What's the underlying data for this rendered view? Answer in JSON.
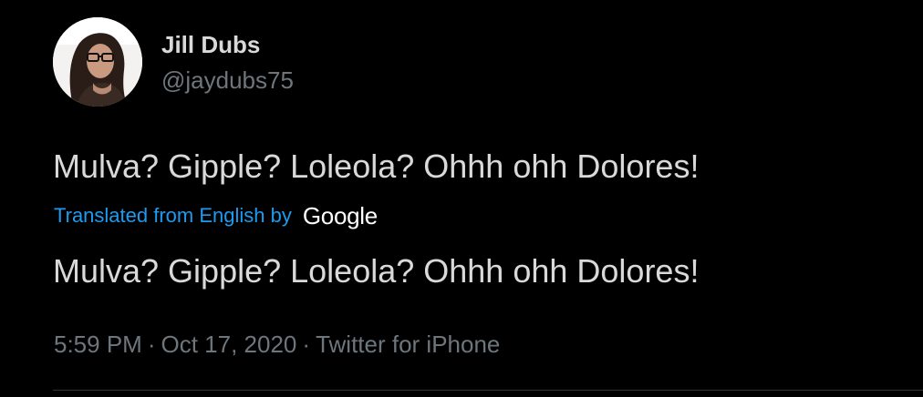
{
  "user": {
    "display_name": "Jill Dubs",
    "handle": "@jaydubs75",
    "avatar_icon": "profile-photo"
  },
  "tweet": {
    "text": "Mulva? Gipple? Loleola? Ohhh ohh Dolores!",
    "translation_label": "Translated from English by",
    "translation_provider": "Google",
    "translated_text": "Mulva? Gipple? Loleola? Ohhh ohh Dolores!",
    "time": "5:59 PM",
    "date": "Oct 17, 2020",
    "source": "Twitter for iPhone",
    "separator": "·"
  },
  "colors": {
    "background": "#000000",
    "primary_text": "#D9D9D9",
    "secondary_text": "#6E767D",
    "link": "#1D9BF0",
    "divider": "#2F3336"
  }
}
